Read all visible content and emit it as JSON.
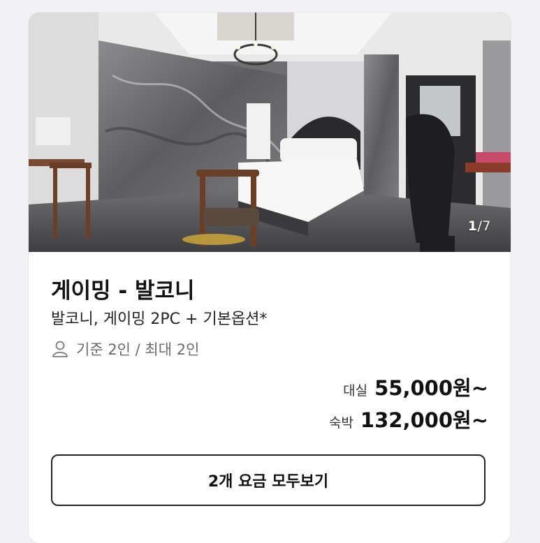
{
  "room": {
    "image_counter": {
      "current": "1",
      "total": "/7"
    },
    "title": "게이밍 - 발코니",
    "subtitle": "발코니, 게이밍 2PC + 기본옵션*",
    "capacity": "기준 2인 / 최대 2인",
    "prices": {
      "day_use_label": "대실",
      "day_use_price": "55,000원~",
      "overnight_label": "숙박",
      "overnight_price": "132,000원~"
    },
    "view_all_button": "2개 요금 모두보기"
  }
}
